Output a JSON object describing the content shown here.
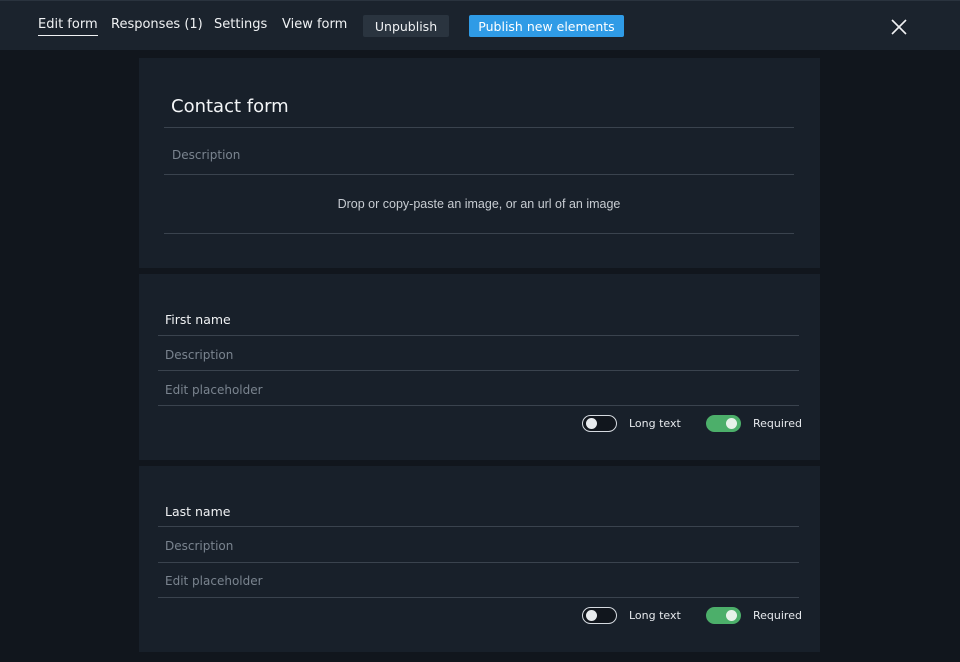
{
  "nav": {
    "edit_form": "Edit form",
    "responses": "Responses (1)",
    "settings": "Settings",
    "view_form": "View form",
    "unpublish": "Unpublish",
    "publish_new": "Publish new elements"
  },
  "form": {
    "title": "Contact form",
    "description_placeholder": "Description",
    "image_drop": "Drop or copy-paste an image, or an url of an image"
  },
  "fields": [
    {
      "label": "First name",
      "description_placeholder": "Description",
      "placeholder_hint": "Edit placeholder",
      "long_text_label": "Long text",
      "long_text_on": false,
      "required_label": "Required",
      "required_on": true
    },
    {
      "label": "Last name",
      "description_placeholder": "Description",
      "placeholder_hint": "Edit placeholder",
      "long_text_label": "Long text",
      "long_text_on": false,
      "required_label": "Required",
      "required_on": true
    }
  ],
  "colors": {
    "background": "#11161d",
    "topbar": "#1b232d",
    "card": "#18202a",
    "publish_button": "#2f9be6",
    "toggle_on": "#4caf6a"
  },
  "icons": {
    "close": "close-icon"
  }
}
